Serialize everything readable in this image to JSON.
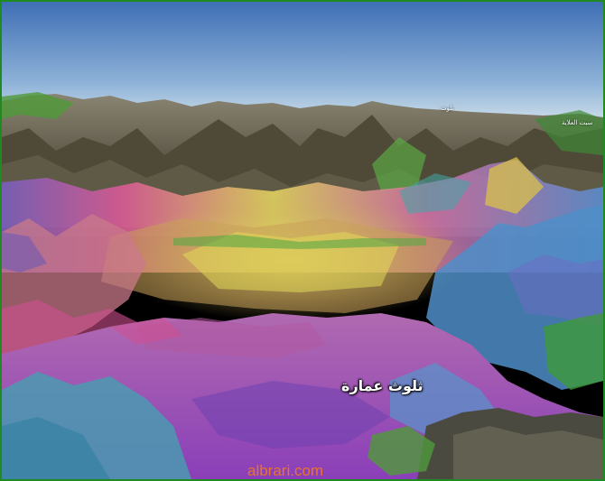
{
  "map": {
    "place_label": "ثلوث عمارة",
    "distant_label_1": "ثلوث",
    "distant_label_2": "سبت العلاية",
    "watermark": "albrari.com"
  },
  "colors": {
    "frame_border": "#1f8a1f",
    "watermark": "#e8742a",
    "sky_top": "#3f6fb5",
    "sky_horizon": "#c9dbe8"
  }
}
